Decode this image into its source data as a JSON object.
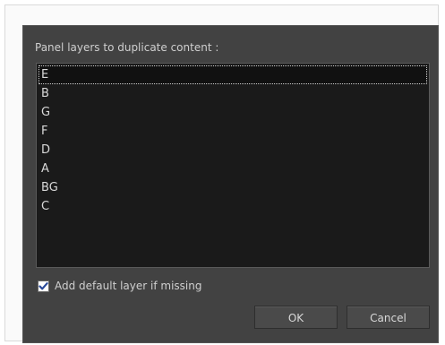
{
  "dialog": {
    "prompt": "Panel layers to duplicate content :",
    "layers": [
      "E",
      "B",
      "G",
      "F",
      "D",
      "A",
      "BG",
      "C"
    ],
    "selected_layer": "E",
    "add_default_layer": {
      "label": "Add default layer if missing",
      "checked": true
    },
    "buttons": {
      "ok": "OK",
      "cancel": "Cancel"
    }
  }
}
